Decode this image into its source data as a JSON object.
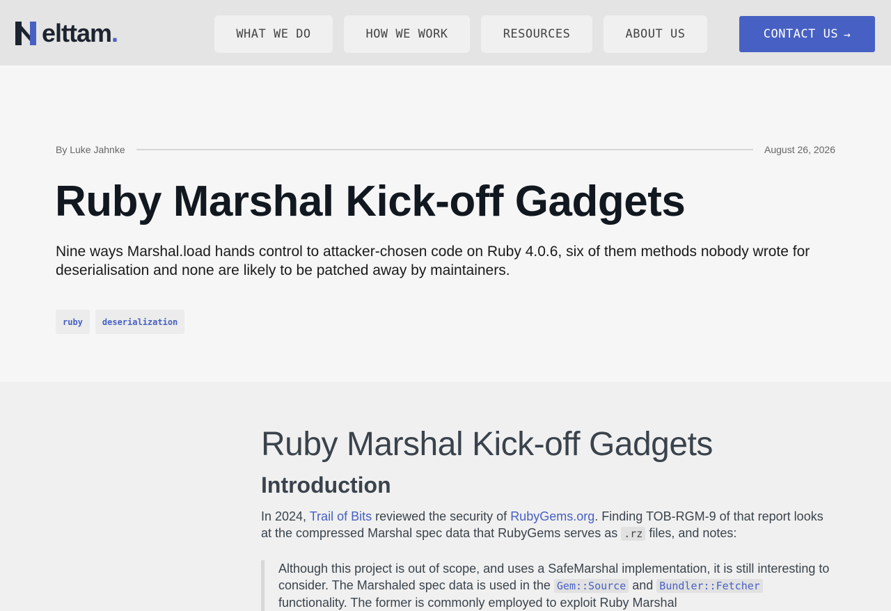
{
  "header": {
    "logo_text": "elttam",
    "logo_dot": ".",
    "nav": [
      "WHAT WE DO",
      "HOW WE WORK",
      "RESOURCES",
      "ABOUT US"
    ],
    "contact_label": "CONTACT US",
    "contact_icon": "arrow-right-icon"
  },
  "hero": {
    "author": "By Luke Jahnke",
    "date": "August 26, 2026",
    "title": "Ruby Marshal Kick-off Gadgets",
    "subtitle": "Nine ways Marshal.load hands control to attacker-chosen code on Ruby 4.0.6, six of them methods nobody wrote for deserialisation and none are likely to be patched away by maintainers.",
    "tags": [
      "ruby",
      "deserialization"
    ]
  },
  "article": {
    "title": "Ruby Marshal Kick-off Gadgets",
    "section_heading": "Introduction",
    "intro": {
      "t1": "In 2024, ",
      "link1": "Trail of Bits",
      "t2": " reviewed the security of ",
      "link2": "RubyGems.org",
      "t3": ". Finding TOB-RGM-9 of that report looks at the compressed Marshal spec data that RubyGems serves as ",
      "code1": ".rz",
      "t4": " files, and notes:"
    },
    "quote": {
      "t1": "Although this project is out of scope, and uses a SafeMarshal implementation, it is still interesting to consider. The Marshaled spec data is used in the ",
      "code1": "Gem::Source",
      "t2": " and ",
      "code2": "Bundler::Fetcher",
      "t3": " functionality. The former is commonly employed to exploit Ruby Marshal"
    }
  },
  "colors": {
    "accent": "#4760c3",
    "header_bg": "#e4e4e4",
    "hero_bg": "#f6f6f6",
    "body_bg": "#f0f0f0"
  }
}
